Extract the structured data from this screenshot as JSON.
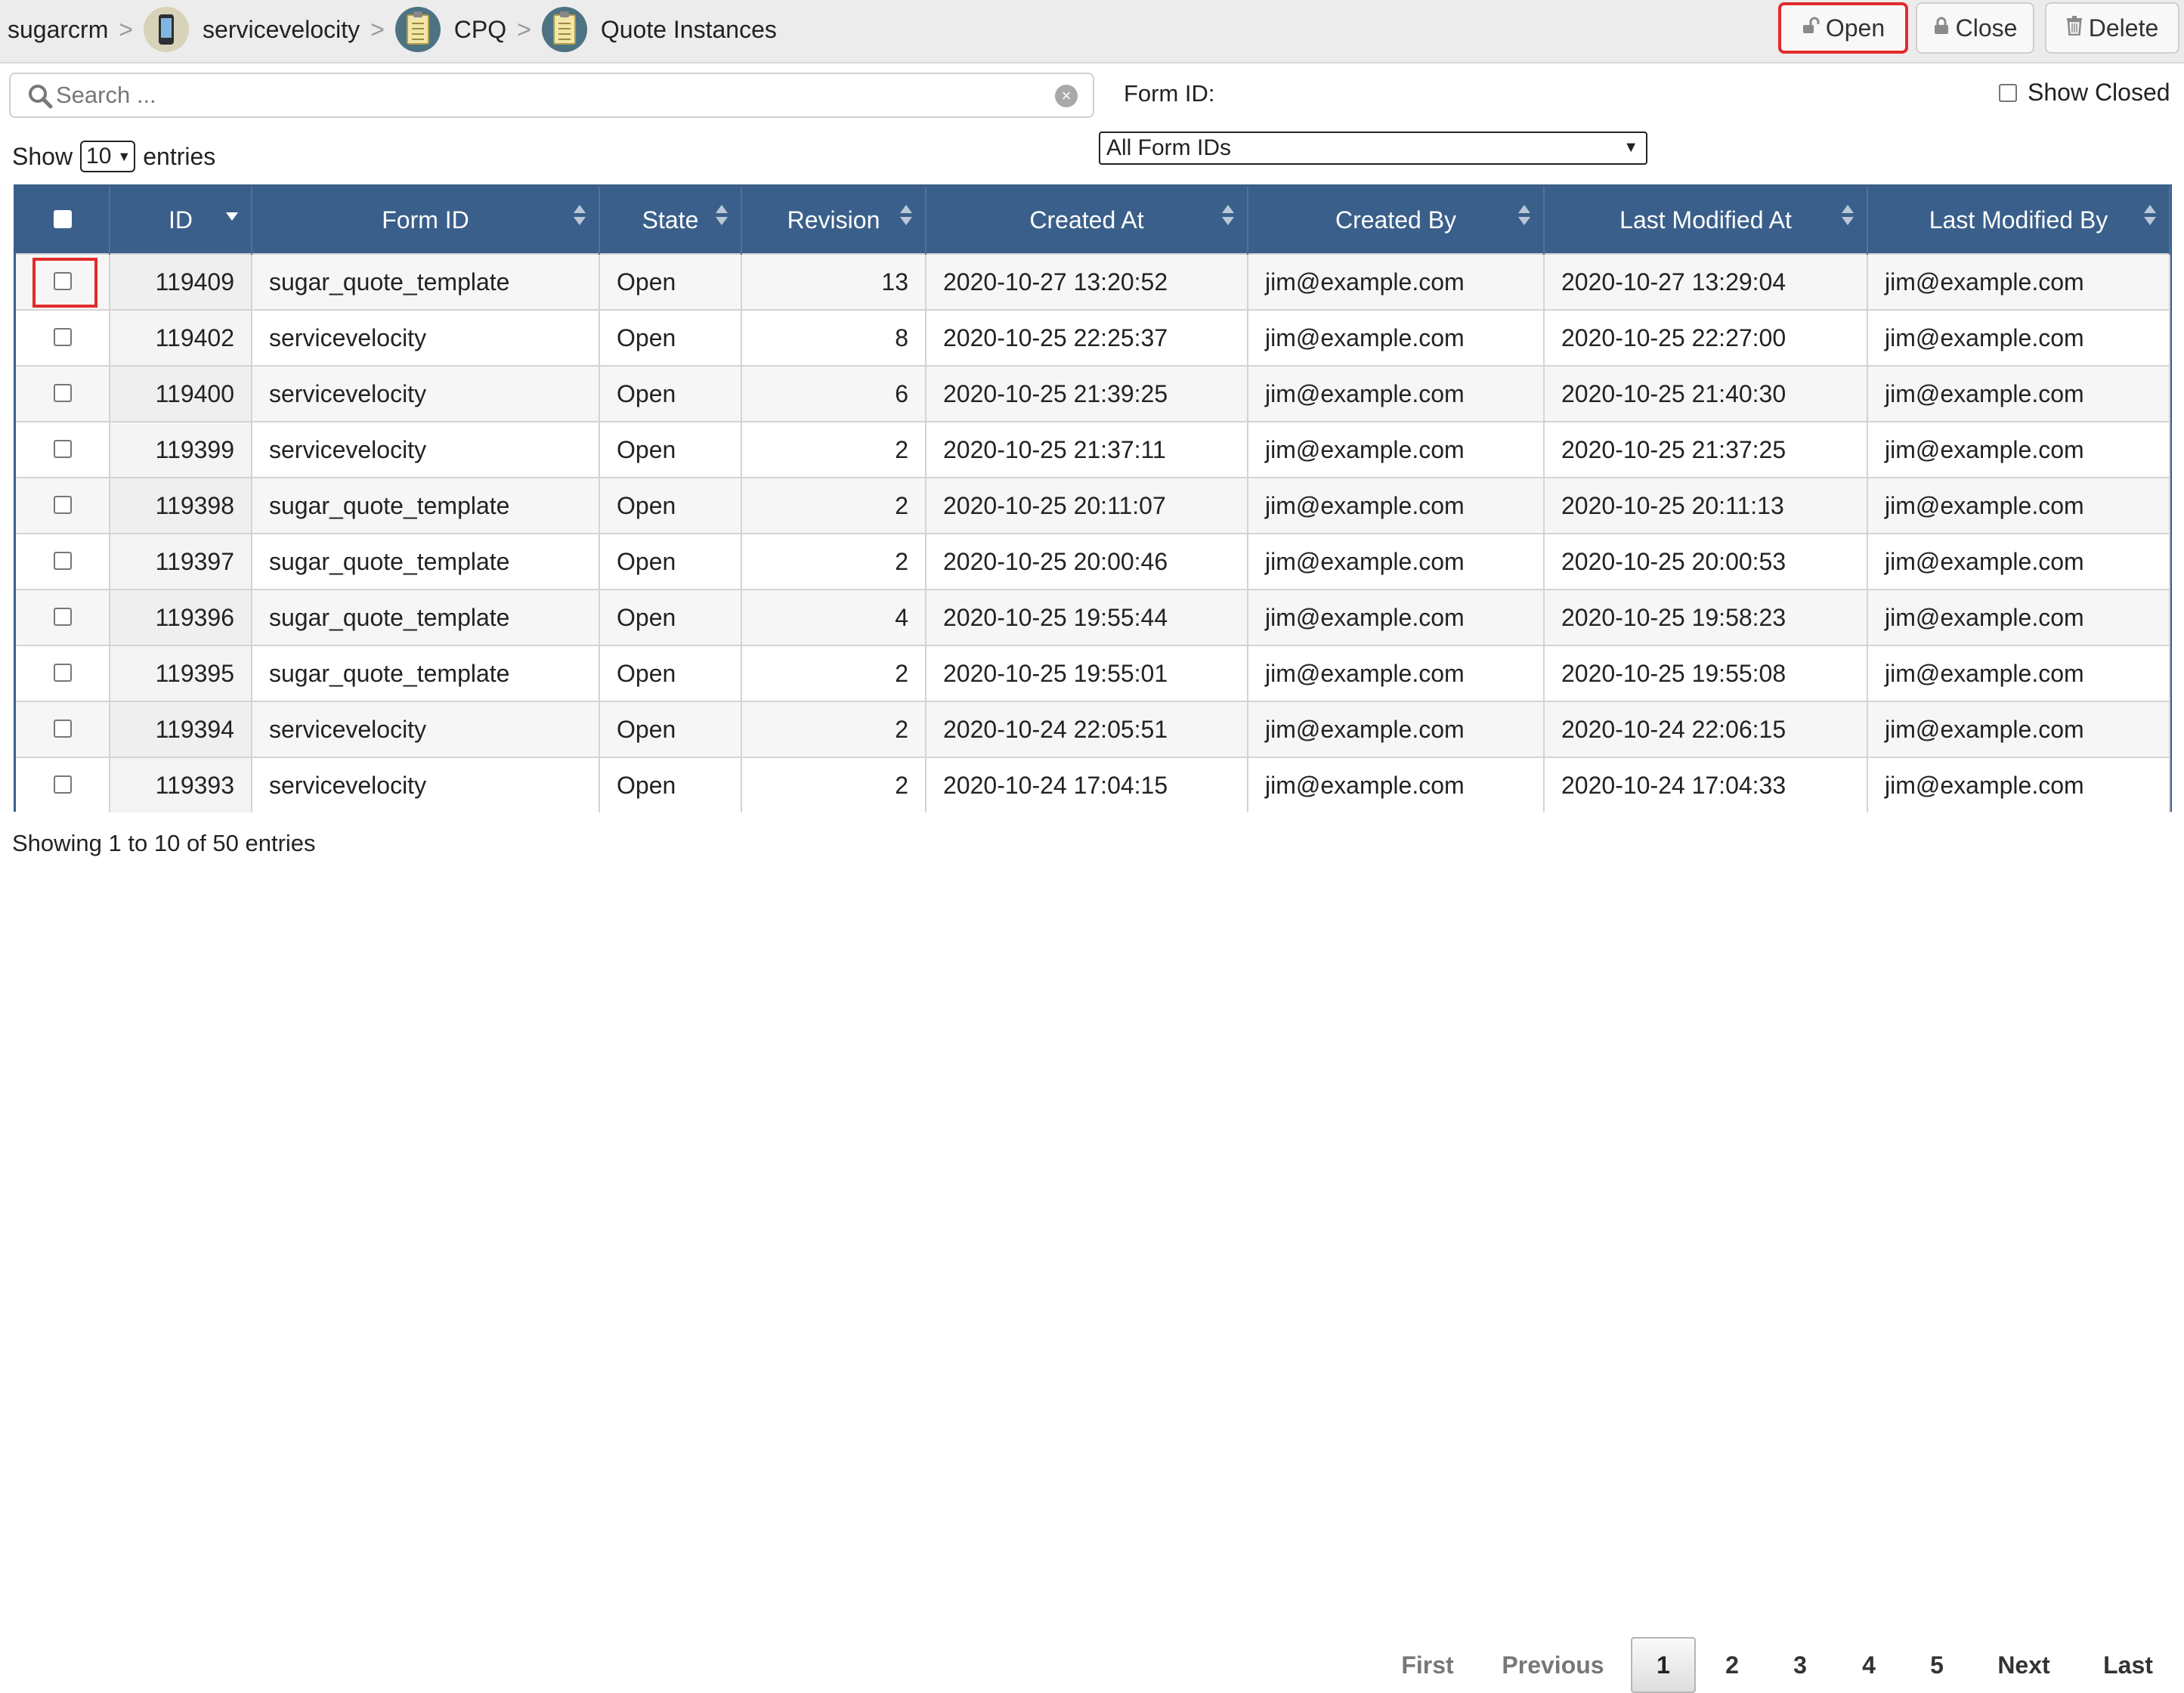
{
  "breadcrumb": {
    "items": [
      {
        "label": "sugarcrm",
        "icon": ""
      },
      {
        "label": "servicevelocity",
        "icon": "phone-icon"
      },
      {
        "label": "CPQ",
        "icon": "clipboard-icon"
      },
      {
        "label": "Quote Instances",
        "icon": "clipboard-icon"
      }
    ],
    "separator": ">"
  },
  "toolbar": {
    "open_label": "Open",
    "close_label": "Close",
    "delete_label": "Delete"
  },
  "search": {
    "placeholder": "Search ..."
  },
  "filter": {
    "form_id_label": "Form ID:",
    "form_id_selected": "All Form IDs",
    "show_closed_label": "Show Closed"
  },
  "length": {
    "show_label": "Show",
    "value": "10",
    "entries_label": "entries"
  },
  "table": {
    "columns": [
      "ID",
      "Form ID",
      "State",
      "Revision",
      "Created At",
      "Created By",
      "Last Modified At",
      "Last Modified By"
    ],
    "rows": [
      {
        "id": "119409",
        "form_id": "sugar_quote_template",
        "state": "Open",
        "revision": "13",
        "created_at": "2020-10-27 13:20:52",
        "created_by": "jim@example.com",
        "modified_at": "2020-10-27 13:29:04",
        "modified_by": "jim@example.com"
      },
      {
        "id": "119402",
        "form_id": "servicevelocity",
        "state": "Open",
        "revision": "8",
        "created_at": "2020-10-25 22:25:37",
        "created_by": "jim@example.com",
        "modified_at": "2020-10-25 22:27:00",
        "modified_by": "jim@example.com"
      },
      {
        "id": "119400",
        "form_id": "servicevelocity",
        "state": "Open",
        "revision": "6",
        "created_at": "2020-10-25 21:39:25",
        "created_by": "jim@example.com",
        "modified_at": "2020-10-25 21:40:30",
        "modified_by": "jim@example.com"
      },
      {
        "id": "119399",
        "form_id": "servicevelocity",
        "state": "Open",
        "revision": "2",
        "created_at": "2020-10-25 21:37:11",
        "created_by": "jim@example.com",
        "modified_at": "2020-10-25 21:37:25",
        "modified_by": "jim@example.com"
      },
      {
        "id": "119398",
        "form_id": "sugar_quote_template",
        "state": "Open",
        "revision": "2",
        "created_at": "2020-10-25 20:11:07",
        "created_by": "jim@example.com",
        "modified_at": "2020-10-25 20:11:13",
        "modified_by": "jim@example.com"
      },
      {
        "id": "119397",
        "form_id": "sugar_quote_template",
        "state": "Open",
        "revision": "2",
        "created_at": "2020-10-25 20:00:46",
        "created_by": "jim@example.com",
        "modified_at": "2020-10-25 20:00:53",
        "modified_by": "jim@example.com"
      },
      {
        "id": "119396",
        "form_id": "sugar_quote_template",
        "state": "Open",
        "revision": "4",
        "created_at": "2020-10-25 19:55:44",
        "created_by": "jim@example.com",
        "modified_at": "2020-10-25 19:58:23",
        "modified_by": "jim@example.com"
      },
      {
        "id": "119395",
        "form_id": "sugar_quote_template",
        "state": "Open",
        "revision": "2",
        "created_at": "2020-10-25 19:55:01",
        "created_by": "jim@example.com",
        "modified_at": "2020-10-25 19:55:08",
        "modified_by": "jim@example.com"
      },
      {
        "id": "119394",
        "form_id": "servicevelocity",
        "state": "Open",
        "revision": "2",
        "created_at": "2020-10-24 22:05:51",
        "created_by": "jim@example.com",
        "modified_at": "2020-10-24 22:06:15",
        "modified_by": "jim@example.com"
      },
      {
        "id": "119393",
        "form_id": "servicevelocity",
        "state": "Open",
        "revision": "2",
        "created_at": "2020-10-24 17:04:15",
        "created_by": "jim@example.com",
        "modified_at": "2020-10-24 17:04:33",
        "modified_by": "jim@example.com"
      }
    ]
  },
  "footer": {
    "info": "Showing 1 to 10 of 50 entries",
    "pagination": {
      "first": "First",
      "previous": "Previous",
      "pages": [
        "1",
        "2",
        "3",
        "4",
        "5"
      ],
      "current": "1",
      "next": "Next",
      "last": "Last"
    }
  },
  "colors": {
    "table_header": "#3a5f8a",
    "highlight": "#e32a2a",
    "topbar": "#ececec"
  }
}
